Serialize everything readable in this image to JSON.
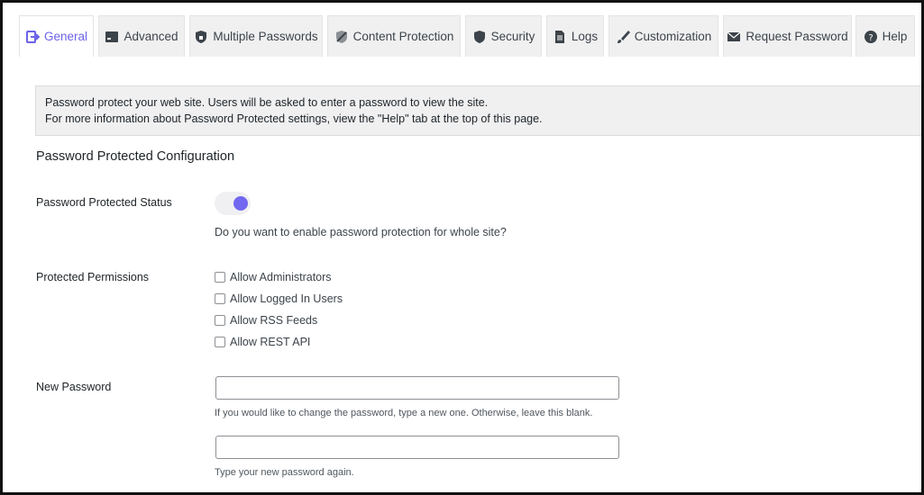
{
  "tabs": [
    {
      "label": "General",
      "icon": "sign-in-icon",
      "active": true
    },
    {
      "label": "Advanced",
      "icon": "admin-generic-icon",
      "active": false
    },
    {
      "label": "Multiple Passwords",
      "icon": "shield-lock-icon",
      "active": false
    },
    {
      "label": "Content Protection",
      "icon": "protection-icon",
      "active": false
    },
    {
      "label": "Security",
      "icon": "shield-icon",
      "active": false
    },
    {
      "label": "Logs",
      "icon": "document-icon",
      "active": false
    },
    {
      "label": "Customization",
      "icon": "brush-icon",
      "active": false
    },
    {
      "label": "Request Password",
      "icon": "envelope-icon",
      "active": false
    },
    {
      "label": "Help",
      "icon": "help-icon",
      "active": false
    }
  ],
  "notice": {
    "line1": "Password protect your web site. Users will be asked to enter a password to view the site.",
    "line2": "For more information about Password Protected settings, view the \"Help\" tab at the top of this page."
  },
  "section_title": "Password Protected Configuration",
  "status": {
    "label": "Password Protected Status",
    "enabled": true,
    "description": "Do you want to enable password protection for whole site?"
  },
  "permissions": {
    "label": "Protected Permissions",
    "options": [
      {
        "label": "Allow Administrators",
        "checked": false
      },
      {
        "label": "Allow Logged In Users",
        "checked": false
      },
      {
        "label": "Allow RSS Feeds",
        "checked": false
      },
      {
        "label": "Allow REST API",
        "checked": false
      }
    ]
  },
  "new_password": {
    "label": "New Password",
    "value": "",
    "help": "If you would like to change the password, type a new one. Otherwise, leave this blank.",
    "confirm_value": "",
    "confirm_help": "Type your new password again."
  },
  "colors": {
    "accent": "#7267ef",
    "tab_bg": "#f0f0f1",
    "notice_bg": "#f0f0f1"
  }
}
